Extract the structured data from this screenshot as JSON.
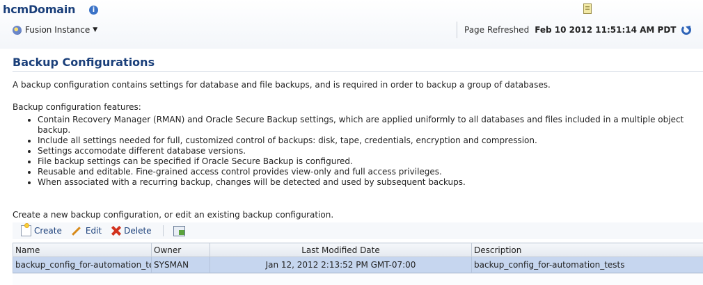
{
  "header": {
    "domain_title": "hcmDomain",
    "info_icon": "info-icon",
    "instance_menu_label": "Fusion Instance",
    "refreshed_label": "Page Refreshed",
    "refreshed_time": "Feb 10 2012 11:51:14 AM PDT"
  },
  "section": {
    "title": "Backup Configurations",
    "intro": "A backup configuration contains settings for database and file backups, and is required in order to backup a group of databases.",
    "features_heading": "Backup configuration features:",
    "features": [
      "Contain Recovery Manager (RMAN) and Oracle Secure Backup settings, which are applied uniformly to all databases and files included in a multiple object backup.",
      "Include all settings needed for full, customized control of backups: disk, tape, credentials, encryption and compression.",
      "Settings accomodate different database versions.",
      "File backup settings can be specified if Oracle Secure Backup is configured.",
      "Reusable and editable. Fine-grained access control provides view-only and full access privileges.",
      "When associated with a recurring backup, changes will be detected and used by subsequent backups."
    ],
    "create_prompt": "Create a new backup configuration, or edit an existing backup configuration."
  },
  "toolbar": {
    "create_label": "Create",
    "edit_label": "Edit",
    "delete_label": "Delete"
  },
  "table": {
    "columns": [
      "Name",
      "Owner",
      "Last Modified Date",
      "Description"
    ],
    "rows": [
      {
        "name": "backup_config_for-automation_tests",
        "owner": "SYSMAN",
        "last_modified": "Jan 12, 2012 2:13:52 PM GMT-07:00",
        "description": "backup_config_for-automation_tests"
      }
    ]
  },
  "colors": {
    "title_blue": "#1a3f7a",
    "selected_row": "#c6d6ef",
    "header_bg": "#e4e9f0"
  }
}
